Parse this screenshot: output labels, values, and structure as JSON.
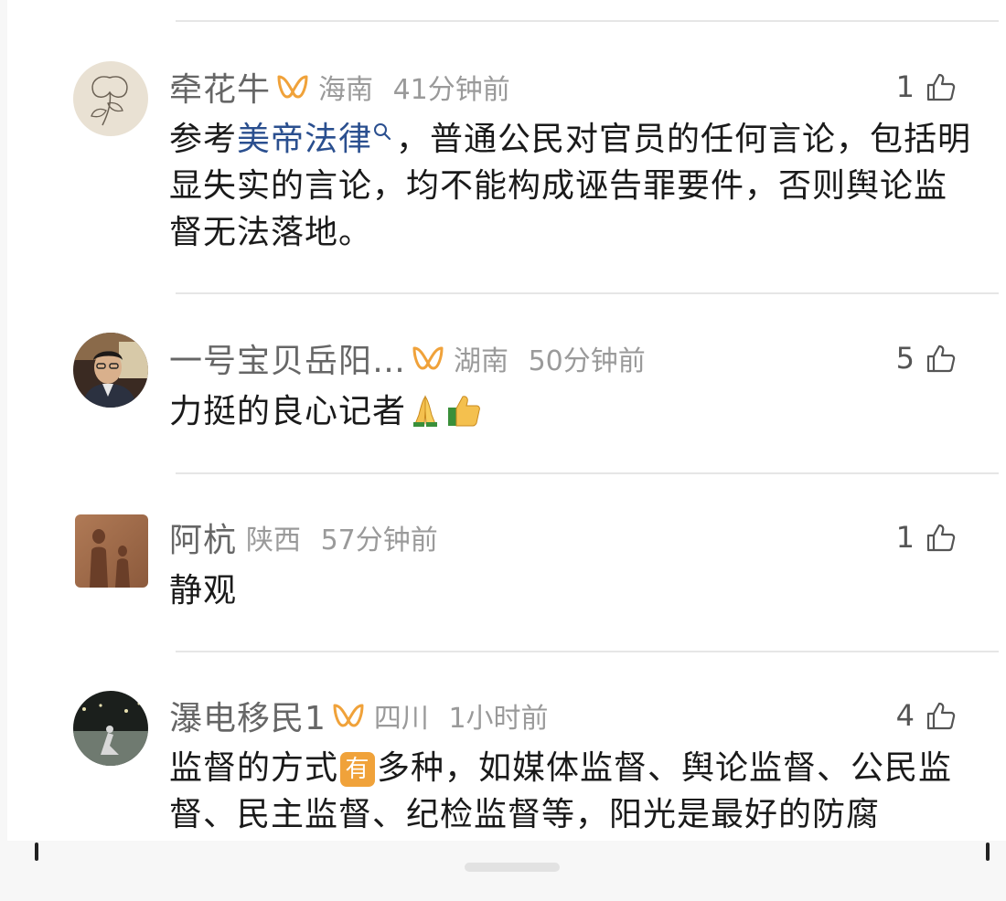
{
  "comments": [
    {
      "username": "牵花牛",
      "vip": true,
      "location": "海南",
      "time": "41分钟前",
      "likes": "1",
      "content_pre": "参考",
      "content_link": "美帝法律",
      "content_post": "，普通公民对官员的任何言论，包括明显失实的言论，均不能构成诬告罪要件，否则舆论监督无法落地。",
      "avatar_icon": "flower-sketch-avatar"
    },
    {
      "username": "一号宝贝岳阳…",
      "vip": true,
      "location": "湖南",
      "time": "50分钟前",
      "likes": "5",
      "content": "力挺的良心记者",
      "emojis": [
        "pray-emoji",
        "thumbs-up-emoji"
      ],
      "avatar_icon": "man-photo-avatar"
    },
    {
      "username": "阿杭",
      "vip": false,
      "location": "陕西",
      "time": "57分钟前",
      "likes": "1",
      "content": "静观",
      "avatar_icon": "silhouette-photo-avatar"
    },
    {
      "username": "瀑电移民1",
      "vip": true,
      "location": "四川",
      "time": "1小时前",
      "likes": "4",
      "content_pre": "监督的方式",
      "content_badge": "有",
      "content_post": "多种，如媒体监督、舆论监督、公民监督、民主监督、纪检监督等，阳光是最好的防腐",
      "avatar_icon": "street-photo-avatar"
    }
  ],
  "colors": {
    "link": "#2a4f8f",
    "vip_icon": "#f0a23a",
    "meta_text": "#9a9a9a",
    "username_text": "#666666"
  }
}
